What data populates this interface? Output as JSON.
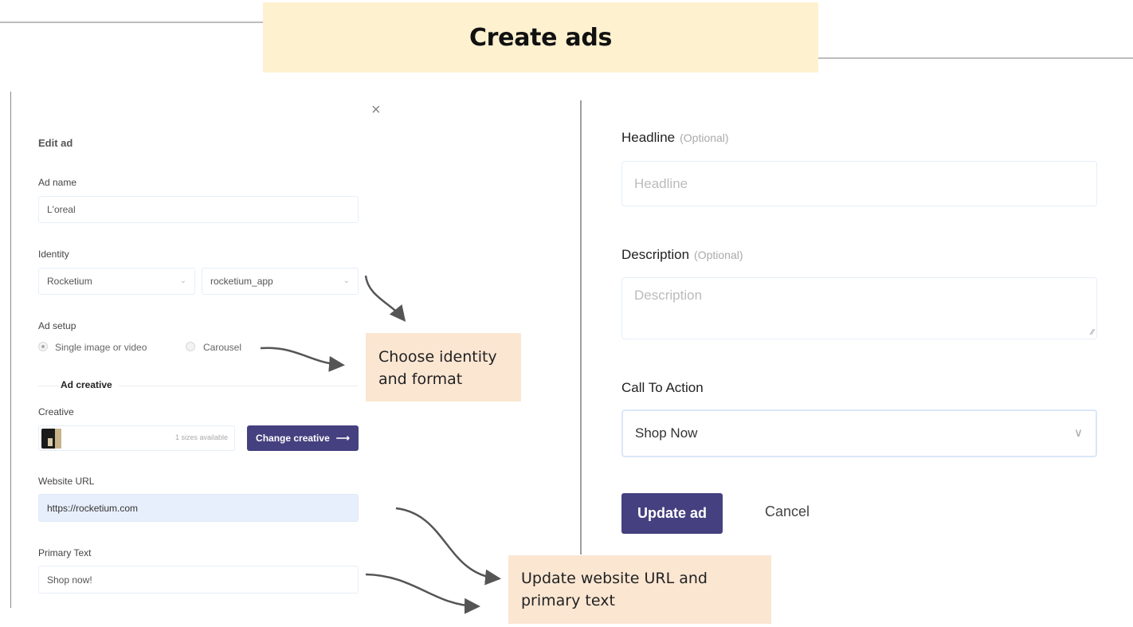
{
  "slide": {
    "title": "Create ads"
  },
  "dialog": {
    "title": "Edit ad",
    "close_icon": "×",
    "ad_name": {
      "label": "Ad name",
      "value": "L'oreal"
    },
    "identity": {
      "label": "Identity",
      "page_select": {
        "value": "Rocketium"
      },
      "account_select": {
        "value": "rocketium_app"
      },
      "chevron": "⌄"
    },
    "ad_setup": {
      "label": "Ad setup",
      "options": [
        {
          "label": "Single image or video",
          "checked": true
        },
        {
          "label": "Carousel",
          "checked": false
        }
      ]
    },
    "ad_creative": {
      "section_title": "Ad creative",
      "creative_label": "Creative",
      "sizes_text": "1 sizes available",
      "change_button": "Change creative",
      "change_icon": "⟶"
    },
    "website_url": {
      "label": "Website URL",
      "value": "https://rocketium.com"
    },
    "primary_text": {
      "label": "Primary Text",
      "value": "Shop now!"
    },
    "headline": {
      "label": "Headline",
      "optional": "(Optional)",
      "placeholder": "Headline"
    },
    "description": {
      "label": "Description",
      "optional": "(Optional)",
      "placeholder": "Description"
    },
    "call_to_action": {
      "label": "Call To Action",
      "value": "Shop Now",
      "chevron": "∨"
    },
    "update_button": "Update ad",
    "cancel_button": "Cancel"
  },
  "callouts": {
    "identity_format": [
      "Choose identity",
      "and format"
    ],
    "url_text": [
      "Update website URL and",
      "primary text"
    ]
  },
  "colors": {
    "title_bg": "#fdf1cf",
    "callout_bg": "#fbe6d2",
    "primary_button": "#45407f",
    "url_field_bg": "#e8effc"
  }
}
